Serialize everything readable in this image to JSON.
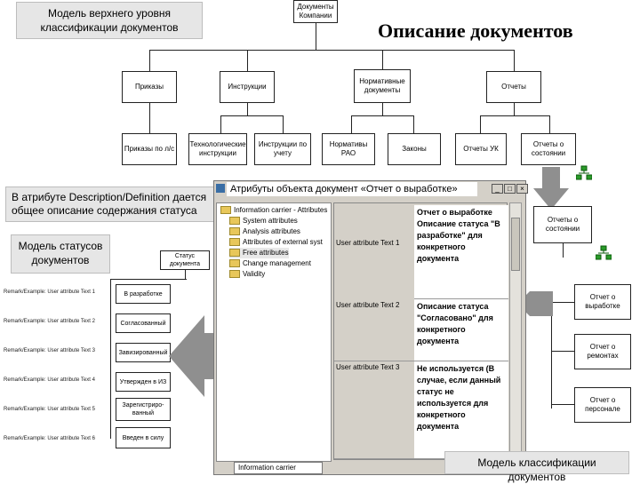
{
  "slide": {
    "title": "Описание документов",
    "top_model_label": "Модель верхнего уровня классификации документов",
    "status_model_label": "Модель статусов документов",
    "desc_note": "В атрибуте Description/Definition дается общее описание содержания статуса",
    "bottom_model_label": "Модель классификации документов"
  },
  "tree_top": {
    "root": "Документы Компании",
    "level1": [
      "Приказы",
      "Инструкции",
      "Нормативные документы",
      "Отчеты"
    ],
    "level2": [
      "Приказы по л/с",
      "Технологические инструкции",
      "Инструкции по учету",
      "Нормативы РАО",
      "Законы",
      "Отчеты УК",
      "Отчеты о состоянии"
    ]
  },
  "window": {
    "title": "Атрибуты объекта документ «Отчет о выработке»",
    "min": "_",
    "max": "□",
    "close": "×",
    "tree_items": [
      "Information carrier - Attributes",
      "System attributes",
      "Analysis attributes",
      "Attributes of external syst",
      "Free attributes",
      "Change management",
      "Validity"
    ],
    "tab": "Information carrier",
    "attributes": [
      {
        "name": "User attribute Text 1",
        "value": "Отчет о выработке\nОписание статуса \"В разработке\" для конкретного документа"
      },
      {
        "name": "User attribute Text 2",
        "value": "Описание статуса \"Согласовано\" для конкретного документа"
      },
      {
        "name": "User attribute Text 3",
        "value": "Не используется (В случае, если данный статус не используется для конкретного документа"
      }
    ]
  },
  "status_model": {
    "root": "Статус документа",
    "rows": [
      {
        "label": "Remark/Example: User attribute Text 1",
        "node": "В разработке"
      },
      {
        "label": "Remark/Example: User attribute Text 2",
        "node": "Согласованный"
      },
      {
        "label": "Remark/Example: User attribute Text 3",
        "node": "Завизированный"
      },
      {
        "label": "Remark/Example: User attribute Text 4",
        "node": "Утвержден в ИЗ"
      },
      {
        "label": "Remark/Example: User attribute Text 5",
        "node": "Зарегистриро-ванный"
      },
      {
        "label": "Remark/Example: User attribute Text 6",
        "node": "Введен в силу"
      }
    ]
  },
  "right_docs": [
    "Отчеты о состоянии",
    "Отчет о выработке",
    "Отчет о ремонтах",
    "Отчет о персонале"
  ],
  "colors": {
    "window_bg": "#d4d0c8",
    "arrow": "#8f8f8f",
    "label_box": "#e6e6e6"
  }
}
